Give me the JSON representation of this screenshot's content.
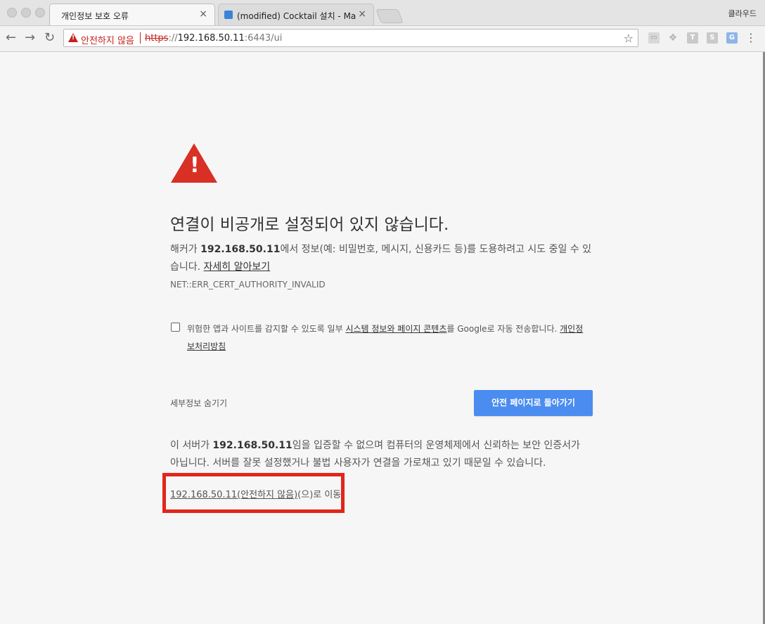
{
  "window": {
    "profile_name": "클라우드"
  },
  "tabs": [
    {
      "title": "개인정보 보호 오류",
      "close": "×",
      "active": true
    },
    {
      "title": "(modified) Cocktail 설치 - Mac",
      "close": "×",
      "active": false
    }
  ],
  "toolbar": {
    "back": "←",
    "forward": "→",
    "reload": "↻",
    "security_label": "안전하지 않음",
    "url_scheme": "https",
    "url_sep": "://",
    "url_host": "192.168.50.11",
    "url_rest": ":6443/ui",
    "star": "☆",
    "extensions": [
      "▭",
      "❖",
      "T",
      "S",
      "G"
    ],
    "menu": "⋮"
  },
  "interstitial": {
    "heading": "연결이 비공개로 설정되어 있지 않습니다.",
    "para1_prefix": "해커가 ",
    "para1_host": "192.168.50.11",
    "para1_suffix": "에서 정보(예: 비밀번호, 메시지, 신용카드 등)를 도용하려고 시도 중일 수 있습니다. ",
    "learn_more": "자세히 알아보기",
    "error_code": "NET::ERR_CERT_AUTHORITY_INVALID",
    "checkbox_text_prefix": "위험한 앱과 사이트를 감지할 수 있도록 일부 ",
    "checkbox_link": "시스템 정보와 페이지 콘텐츠",
    "checkbox_text_suffix": "를 Google로 자동 전송합니다. ",
    "privacy_link": "개인정보처리방침",
    "details_toggle": "세부정보 숨기기",
    "back_button": "안전 페이지로 돌아가기",
    "detail_prefix": "이 서버가 ",
    "detail_host": "192.168.50.11",
    "detail_suffix": "임을 입증할 수 없으며 컴퓨터의 운영체제에서 신뢰하는 보안 인증서가 아닙니다. 서버를 잘못 설정했거나 불법 사용자가 연결을 가로채고 있기 때문일 수 있습니다.",
    "proceed_link": "192.168.50.11(안전하지 않음)",
    "proceed_suffix": "(으)로 이동"
  },
  "colors": {
    "warning_red": "#d93025",
    "button_blue": "#4a8cf0",
    "highlight_box": "#e3261b"
  }
}
